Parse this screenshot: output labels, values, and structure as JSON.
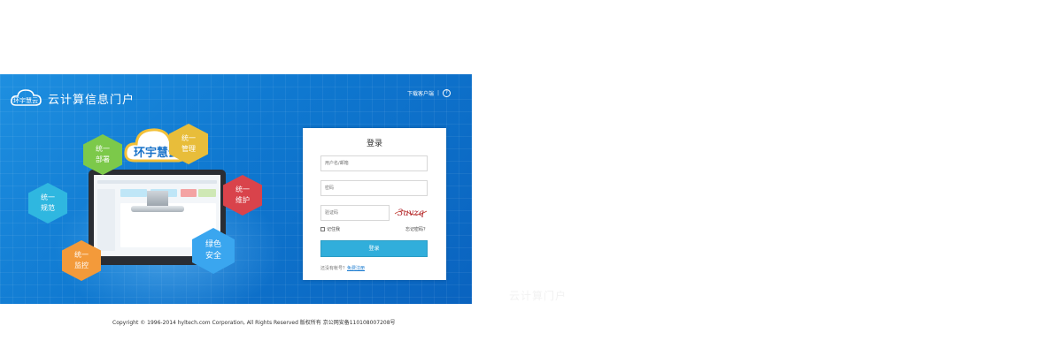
{
  "header": {
    "logo_text": "云计算信息门户",
    "download_link": "下载客户端",
    "help_glyph": "?"
  },
  "hexagons": [
    {
      "label": "统一\n部署",
      "color": "#7cc94a"
    },
    {
      "label": "统一\n管理",
      "color": "#e8bd3a"
    },
    {
      "label": "统一\n规范",
      "color": "#2fb7e0"
    },
    {
      "label": "统一\n维护",
      "color": "#d9434b"
    },
    {
      "label": "绿色\n安全",
      "color": "#3aa6ef"
    },
    {
      "label": "统一\n监控",
      "color": "#f39a3a"
    }
  ],
  "colors": {
    "accent": "#31aedb",
    "banner": "#0f78d0"
  },
  "login": {
    "title": "登录",
    "username_placeholder": "用户名/邮箱",
    "password_placeholder": "密码",
    "captcha_placeholder": "验证码",
    "captcha_text": "3uvzq",
    "remember_label": "记住我",
    "forgot_link": "忘记密码？",
    "submit_label": "登录",
    "register_prompt": "还没有帐号？",
    "register_link": "免费注册"
  },
  "ghost_text": "云计算门户",
  "footer": {
    "copyright": "Copyright © 1996-2014 hyltech.com Corporation, All Rights Reserved 版权所有 京公网安备110108007208号"
  }
}
